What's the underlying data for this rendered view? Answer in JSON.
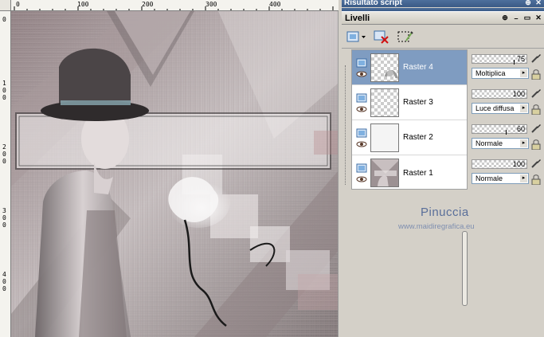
{
  "panels": {
    "script_output_title": "Risultato script",
    "layers_title": "Livelli"
  },
  "rulers": {
    "top_ticks": [
      "0",
      "100",
      "200",
      "300",
      "400"
    ],
    "left_ticks": [
      "0",
      "100",
      "200",
      "300",
      "400"
    ]
  },
  "layers": [
    {
      "name": "Raster 4",
      "opacity": "75",
      "blend": "Moltiplica",
      "selected": true
    },
    {
      "name": "Raster 3",
      "opacity": "100",
      "blend": "Luce diffusa",
      "selected": false
    },
    {
      "name": "Raster 2",
      "opacity": "60",
      "blend": "Normale",
      "selected": false
    },
    {
      "name": "Raster 1",
      "opacity": "100",
      "blend": "Normale",
      "selected": false
    }
  ],
  "watermark": {
    "name": "Pinuccia",
    "url": "www.maidiregrafica.eu"
  },
  "colors": {
    "titlebar": "#3d5f8c",
    "selected_row": "#7f9cc1",
    "canvas_base": "#b2a7a8"
  }
}
